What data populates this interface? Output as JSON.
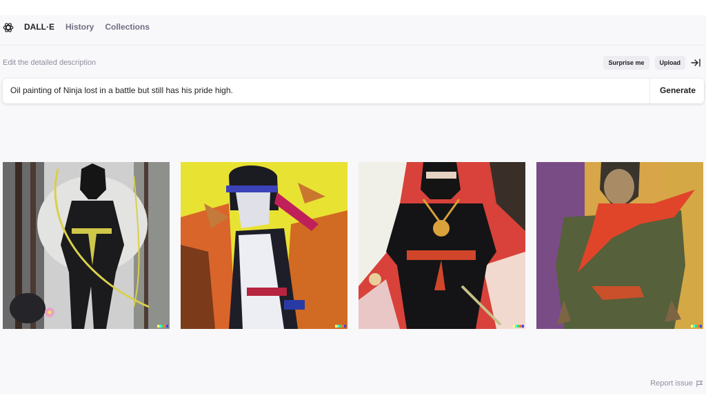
{
  "nav": {
    "brand": "DALL·E",
    "history": "History",
    "collections": "Collections"
  },
  "editor": {
    "label": "Edit the detailed description",
    "surprise_label": "Surprise me",
    "upload_label": "Upload",
    "prompt_text": "Oil painting of  Ninja lost in a battle but still has his pride high.",
    "generate_label": "Generate"
  },
  "images": [
    {
      "subject": "ninja with bow in forest"
    },
    {
      "subject": "ninja with blue headband on yellow background"
    },
    {
      "subject": "ninja with gold medallion on red background"
    },
    {
      "subject": "warrior with red scarf on yellow background"
    }
  ],
  "footer": {
    "report_label": "Report issue"
  },
  "colors": {
    "signature": [
      "#ffff66",
      "#42ffff",
      "#51da4c",
      "#ff6e3c",
      "#3c46ff"
    ]
  }
}
